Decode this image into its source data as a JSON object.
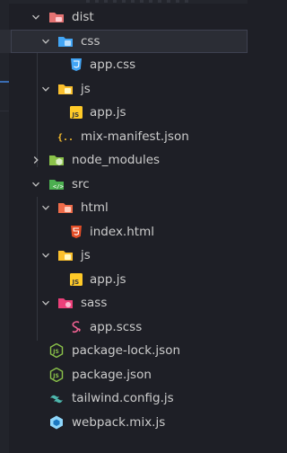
{
  "explorer": {
    "items": [
      {
        "label": "dist",
        "icon": "folder-dist-icon",
        "kind": "folder",
        "expanded": true
      },
      {
        "label": "css",
        "icon": "folder-css-icon",
        "kind": "folder",
        "expanded": true
      },
      {
        "label": "app.css",
        "icon": "css-file-icon",
        "kind": "file"
      },
      {
        "label": "js",
        "icon": "folder-js-icon",
        "kind": "folder",
        "expanded": true
      },
      {
        "label": "app.js",
        "icon": "js-file-icon",
        "kind": "file"
      },
      {
        "label": "mix-manifest.json",
        "icon": "json-braces-icon",
        "kind": "file"
      },
      {
        "label": "node_modules",
        "icon": "folder-node-icon",
        "kind": "folder",
        "expanded": false
      },
      {
        "label": "src",
        "icon": "folder-src-icon",
        "kind": "folder",
        "expanded": true
      },
      {
        "label": "html",
        "icon": "folder-html-icon",
        "kind": "folder",
        "expanded": true
      },
      {
        "label": "index.html",
        "icon": "html-file-icon",
        "kind": "file"
      },
      {
        "label": "js",
        "icon": "folder-js-icon",
        "kind": "folder",
        "expanded": true
      },
      {
        "label": "app.js",
        "icon": "js-file-icon",
        "kind": "file"
      },
      {
        "label": "sass",
        "icon": "folder-sass-icon",
        "kind": "folder",
        "expanded": true
      },
      {
        "label": "app.scss",
        "icon": "sass-file-icon",
        "kind": "file"
      },
      {
        "label": "package-lock.json",
        "icon": "nodejs-file-icon",
        "kind": "file"
      },
      {
        "label": "package.json",
        "icon": "nodejs-file-icon",
        "kind": "file"
      },
      {
        "label": "tailwind.config.js",
        "icon": "tailwind-icon",
        "kind": "file"
      },
      {
        "label": "webpack.mix.js",
        "icon": "webpack-icon",
        "kind": "file"
      }
    ]
  },
  "colors": {
    "background": "#1e1f26",
    "selected_row": "#2b2d35",
    "text": "#cccccc",
    "folder_red": "#e57373",
    "folder_blue": "#42a5f5",
    "folder_yellow": "#fbc02d",
    "folder_green": "#8bc34a",
    "css_blue": "#42a5f5",
    "js_yellow": "#ffca28",
    "html_orange": "#e44d26",
    "sass_pink": "#f06292",
    "node_green": "#8bc34a",
    "tailwind_cyan": "#4db6ac",
    "webpack_blue": "#8ed6fb"
  }
}
